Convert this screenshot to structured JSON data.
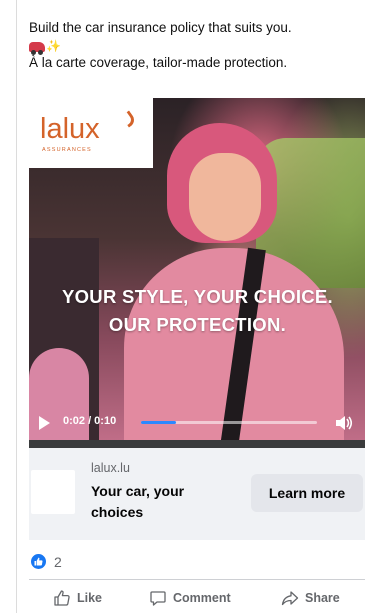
{
  "post": {
    "text_line1": "Build the car insurance policy that suits you.",
    "emoji_sparkle": "✨",
    "text_line2": "À la carte coverage, tailor-made protection."
  },
  "video": {
    "logo_word": "lalux",
    "logo_sub": "ASSURANCES",
    "headline_line1": "YOUR STYLE, YOUR CHOICE.",
    "headline_line2": "OUR PROTECTION.",
    "time": "0:02 / 0:10",
    "progress": 0.2
  },
  "cta": {
    "domain": "lalux.lu",
    "title": "Your car, your choices",
    "button": "Learn more"
  },
  "reactions": {
    "count": "2"
  },
  "actions": {
    "like": "Like",
    "comment": "Comment",
    "share": "Share"
  },
  "colors": {
    "brand": "#d4632a",
    "accent": "#2d88ff",
    "like_blue": "#1877f2"
  }
}
